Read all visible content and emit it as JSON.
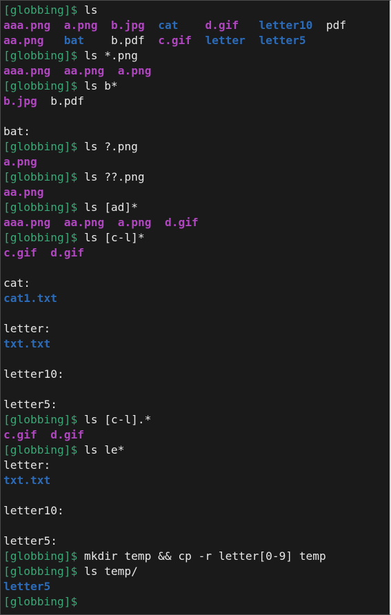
{
  "terminal": {
    "prompt": "[globbing]$",
    "lines": [
      {
        "type": "prompt",
        "cmd": "ls"
      },
      {
        "type": "row",
        "cells": [
          {
            "text": "aaa.png",
            "kind": "img",
            "col": 0
          },
          {
            "text": "a.png",
            "kind": "img",
            "col": 9
          },
          {
            "text": "b.jpg",
            "kind": "img",
            "col": 16
          },
          {
            "text": "cat",
            "kind": "dir",
            "col": 23
          },
          {
            "text": "d.gif",
            "kind": "img",
            "col": 30
          },
          {
            "text": "letter10",
            "kind": "dir",
            "col": 38
          },
          {
            "text": "pdf",
            "kind": "txt",
            "col": 48
          }
        ]
      },
      {
        "type": "row",
        "cells": [
          {
            "text": "aa.png",
            "kind": "img",
            "col": 0
          },
          {
            "text": "bat",
            "kind": "dir",
            "col": 9
          },
          {
            "text": "b.pdf",
            "kind": "txt",
            "col": 16
          },
          {
            "text": "c.gif",
            "kind": "img",
            "col": 23
          },
          {
            "text": "letter",
            "kind": "dir",
            "col": 30
          },
          {
            "text": "letter5",
            "kind": "dir",
            "col": 38
          }
        ]
      },
      {
        "type": "prompt",
        "cmd": "ls *.png"
      },
      {
        "type": "row",
        "cells": [
          {
            "text": "aaa.png",
            "kind": "img",
            "col": 0
          },
          {
            "text": "aa.png",
            "kind": "img",
            "col": 9
          },
          {
            "text": "a.png",
            "kind": "img",
            "col": 17
          }
        ]
      },
      {
        "type": "prompt",
        "cmd": "ls b*"
      },
      {
        "type": "row",
        "cells": [
          {
            "text": "b.jpg",
            "kind": "img",
            "col": 0
          },
          {
            "text": "b.pdf",
            "kind": "txt",
            "col": 7
          }
        ]
      },
      {
        "type": "blank"
      },
      {
        "type": "text",
        "text": "bat:"
      },
      {
        "type": "prompt",
        "cmd": "ls ?.png"
      },
      {
        "type": "row",
        "cells": [
          {
            "text": "a.png",
            "kind": "img",
            "col": 0
          }
        ]
      },
      {
        "type": "prompt",
        "cmd": "ls ??.png"
      },
      {
        "type": "row",
        "cells": [
          {
            "text": "aa.png",
            "kind": "img",
            "col": 0
          }
        ]
      },
      {
        "type": "prompt",
        "cmd": "ls [ad]*"
      },
      {
        "type": "row",
        "cells": [
          {
            "text": "aaa.png",
            "kind": "img",
            "col": 0
          },
          {
            "text": "aa.png",
            "kind": "img",
            "col": 9
          },
          {
            "text": "a.png",
            "kind": "img",
            "col": 17
          },
          {
            "text": "d.gif",
            "kind": "img",
            "col": 24
          }
        ]
      },
      {
        "type": "prompt",
        "cmd": "ls [c-l]*"
      },
      {
        "type": "row",
        "cells": [
          {
            "text": "c.gif",
            "kind": "img",
            "col": 0
          },
          {
            "text": "d.gif",
            "kind": "img",
            "col": 7
          }
        ]
      },
      {
        "type": "blank"
      },
      {
        "type": "text",
        "text": "cat:"
      },
      {
        "type": "row",
        "cells": [
          {
            "text": "cat1.txt",
            "kind": "dir",
            "col": 0
          }
        ]
      },
      {
        "type": "blank"
      },
      {
        "type": "text",
        "text": "letter:"
      },
      {
        "type": "row",
        "cells": [
          {
            "text": "txt.txt",
            "kind": "dir",
            "col": 0
          }
        ]
      },
      {
        "type": "blank"
      },
      {
        "type": "text",
        "text": "letter10:"
      },
      {
        "type": "blank"
      },
      {
        "type": "text",
        "text": "letter5:"
      },
      {
        "type": "prompt",
        "cmd": "ls [c-l].*"
      },
      {
        "type": "row",
        "cells": [
          {
            "text": "c.gif",
            "kind": "img",
            "col": 0
          },
          {
            "text": "d.gif",
            "kind": "img",
            "col": 7
          }
        ]
      },
      {
        "type": "prompt",
        "cmd": "ls le*"
      },
      {
        "type": "text",
        "text": "letter:"
      },
      {
        "type": "row",
        "cells": [
          {
            "text": "txt.txt",
            "kind": "dir",
            "col": 0
          }
        ]
      },
      {
        "type": "blank"
      },
      {
        "type": "text",
        "text": "letter10:"
      },
      {
        "type": "blank"
      },
      {
        "type": "text",
        "text": "letter5:"
      },
      {
        "type": "prompt",
        "cmd": "mkdir temp && cp -r letter[0-9] temp"
      },
      {
        "type": "prompt",
        "cmd": "ls temp/"
      },
      {
        "type": "row",
        "cells": [
          {
            "text": "letter5",
            "kind": "dir",
            "col": 0
          }
        ]
      },
      {
        "type": "prompt",
        "cmd": ""
      }
    ]
  },
  "colors": {
    "background": "#1a1a1a",
    "prompt": "#3aa876",
    "text": "#e8e8e8",
    "image_file": "#b046c0",
    "directory": "#2c6bb8"
  }
}
